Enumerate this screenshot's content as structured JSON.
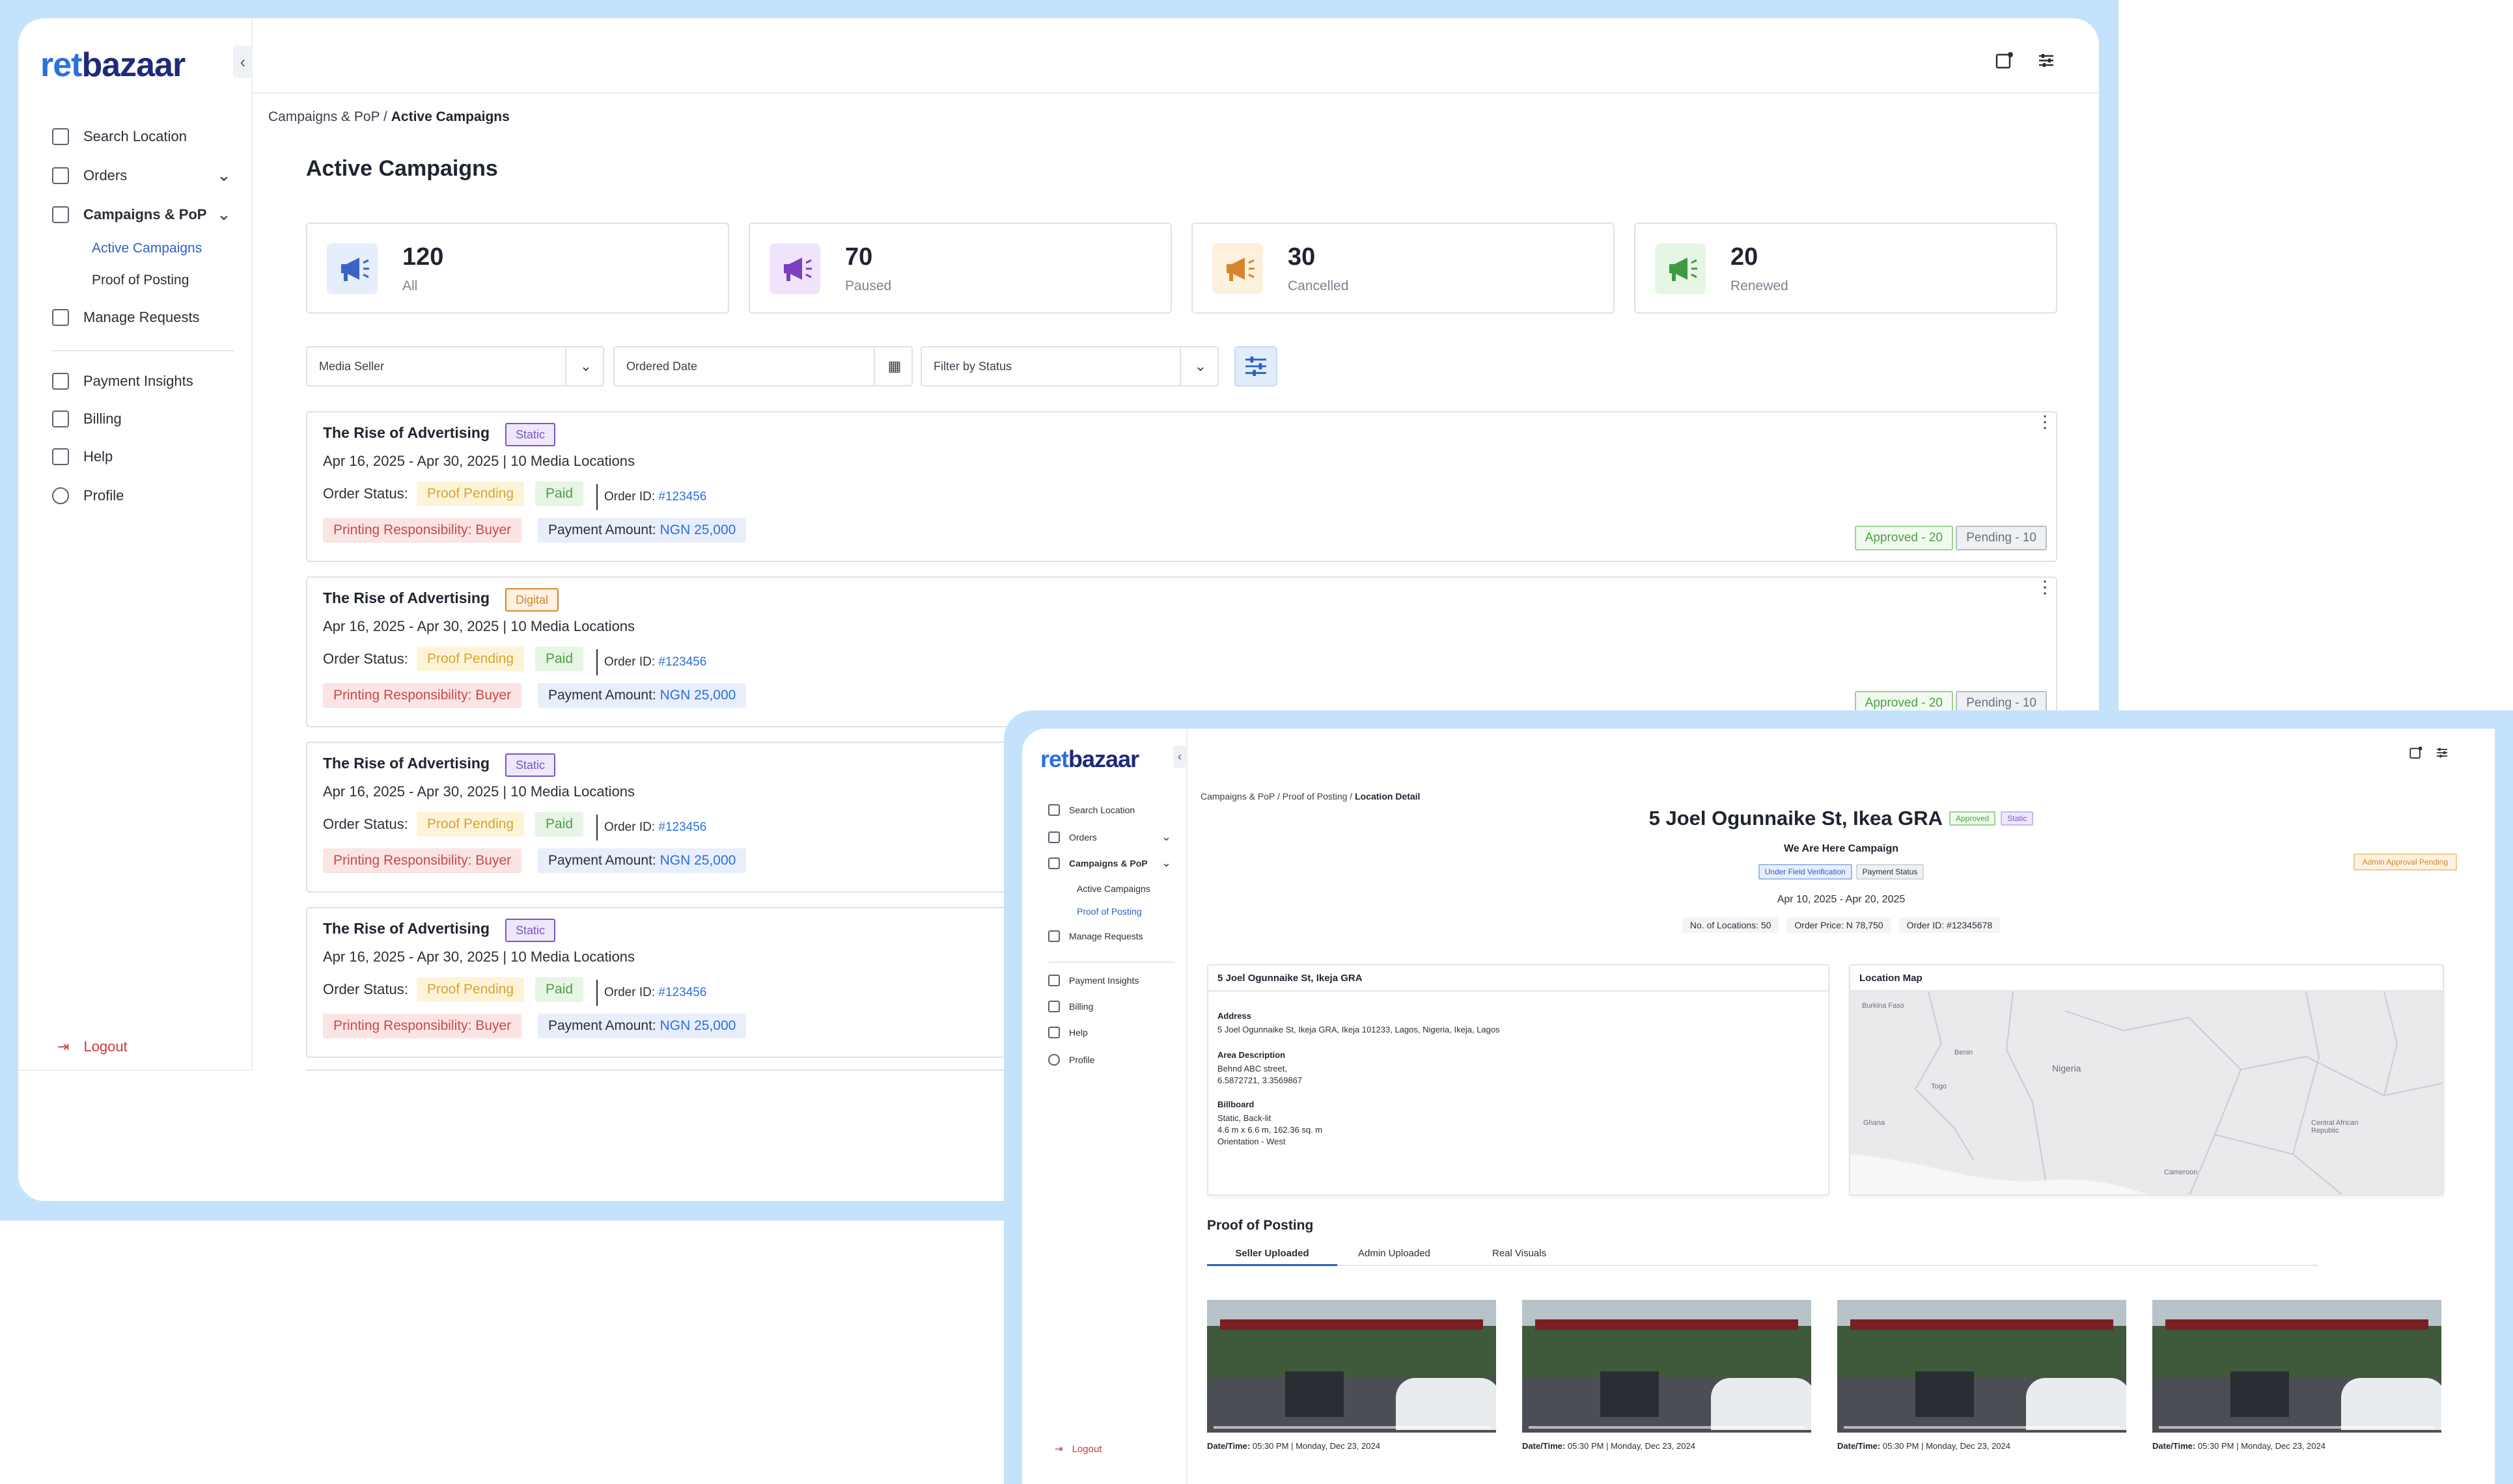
{
  "brand": {
    "logo_part1": "ret",
    "logo_part2": "bazaar",
    "collapse_glyph": "‹"
  },
  "sidebar": {
    "items": [
      {
        "label": "Search Location",
        "icon": "search-location-icon"
      },
      {
        "label": "Orders",
        "icon": "grid-icon"
      },
      {
        "label": "Campaigns & PoP",
        "icon": "campaign-icon"
      },
      {
        "label": "Manage Requests",
        "icon": "requests-icon"
      },
      {
        "label": "Payment Insights",
        "icon": "wallet-icon"
      },
      {
        "label": "Billing",
        "icon": "billing-icon"
      },
      {
        "label": "Help",
        "icon": "mail-icon"
      },
      {
        "label": "Profile",
        "icon": "profile-icon"
      }
    ],
    "sub_active_campaigns": "Active Campaigns",
    "sub_proof_of_posting": "Proof of Posting",
    "logout": "Logout"
  },
  "w1": {
    "breadcrumb_parent": "Campaigns & PoP /",
    "breadcrumb_current": "Active Campaigns",
    "title": "Active Campaigns",
    "stats": [
      {
        "value": "120",
        "label": "All",
        "color": "#3a63c8",
        "bg": "#e6edfb"
      },
      {
        "value": "70",
        "label": "Paused",
        "color": "#7b3fc4",
        "bg": "#efe4fb"
      },
      {
        "value": "30",
        "label": "Cancelled",
        "color": "#d7852a",
        "bg": "#fdf0dc"
      },
      {
        "value": "20",
        "label": "Renewed",
        "color": "#3f9a42",
        "bg": "#e6f6e4"
      }
    ],
    "filters": {
      "media_seller": "Media Seller",
      "ordered_date": "Ordered Date",
      "status": "Filter by Status"
    },
    "cards": [
      {
        "title": "The Rise of Advertising",
        "tag": "Static",
        "dates": "Apr 16, 2025 - Apr 30, 2025  |  10 Media Locations",
        "order_status_label": "Order Status:",
        "proof": "Proof Pending",
        "paid": "Paid",
        "order_id_label": "Order ID:",
        "order_id": "#123456",
        "printing": "Printing Responsibility: Buyer",
        "payment_label": "Payment Amount:",
        "payment_value": "NGN 25,000",
        "approved": "Approved - 20",
        "pending": "Pending - 10"
      },
      {
        "title": "The Rise of Advertising",
        "tag": "Digital",
        "dates": "Apr 16, 2025 - Apr 30, 2025  |  10 Media Locations",
        "order_status_label": "Order Status:",
        "proof": "Proof Pending",
        "paid": "Paid",
        "order_id_label": "Order ID:",
        "order_id": "#123456",
        "printing": "Printing Responsibility: Buyer",
        "payment_label": "Payment Amount:",
        "payment_value": "NGN 25,000",
        "approved": "Approved - 20",
        "pending": "Pending - 10"
      },
      {
        "title": "The Rise of Advertising",
        "tag": "Static",
        "dates": "Apr 16, 2025 - Apr 30, 2025  |  10 Media Locations",
        "order_status_label": "Order Status:",
        "proof": "Proof Pending",
        "paid": "Paid",
        "order_id_label": "Order ID:",
        "order_id": "#123456",
        "printing": "Printing Responsibility: Buyer",
        "payment_label": "Payment Amount:",
        "payment_value": "NGN 25,000"
      },
      {
        "title": "The Rise of Advertising",
        "tag": "Static",
        "dates": "Apr 16, 2025 - Apr 30, 2025  |  10 Media Locations",
        "order_status_label": "Order Status:",
        "proof": "Proof Pending",
        "paid": "Paid",
        "order_id_label": "Order ID:",
        "order_id": "#123456",
        "printing": "Printing Responsibility: Buyer",
        "payment_label": "Payment Amount:",
        "payment_value": "NGN 25,000"
      }
    ]
  },
  "w2": {
    "breadcrumb_parent": "Campaigns & PoP / Proof of Posting /",
    "breadcrumb_current": "Location Detail",
    "title": "5 Joel Ogunnaike St, Ikea GRA",
    "tag_approved": "Approved",
    "tag_static": "Static",
    "campaign": "We Are Here Campaign",
    "tag_ufv": "Under Field Verification",
    "tag_payment": "Payment Status",
    "date_range": "Apr 10, 2025 - Apr 20, 2025",
    "meta": [
      "No. of Locations: 50",
      "Order Price: N 78,750",
      "Order ID: #12345678"
    ],
    "admin_pending": "Admin Approval Pending",
    "detail": {
      "header": "5 Joel Ogunnaike St, Ikeja GRA",
      "address_label": "Address",
      "address": "5 Joel Ogunnaike St, Ikeja GRA, Ikeja 101233, Lagos, Nigeria, Ikeja, Lagos",
      "area_label": "Area Description",
      "area_1": "Behnd ABC street,",
      "area_2": "6.5872721, 3.3569867",
      "billboard_label": "Billboard",
      "billboard_1": "Static, Back-lit",
      "billboard_2": "4.6 m x 6.6 m, 162.36 sq. m",
      "billboard_3": "Orientation - West"
    },
    "map": {
      "header": "Location Map",
      "labels": [
        "Burkina Faso",
        "Benin",
        "Togo",
        "Ghana",
        "Nigeria",
        "Cameroon",
        "Central African Republic"
      ]
    },
    "pop_title": "Proof of Posting",
    "tabs": [
      "Seller Uploaded",
      "Admin Uploaded",
      "Real Visuals"
    ],
    "thumbs": [
      {
        "caption_label": "Date/Time:",
        "caption": "05:30 PM | Monday, Dec 23, 2024"
      },
      {
        "caption_label": "Date/Time:",
        "caption": "05:30 PM | Monday, Dec 23, 2024"
      },
      {
        "caption_label": "Date/Time:",
        "caption": "05:30 PM | Monday, Dec 23, 2024"
      },
      {
        "caption_label": "Date/Time:",
        "caption": "05:30 PM | Monday, Dec 23, 2024"
      }
    ]
  }
}
